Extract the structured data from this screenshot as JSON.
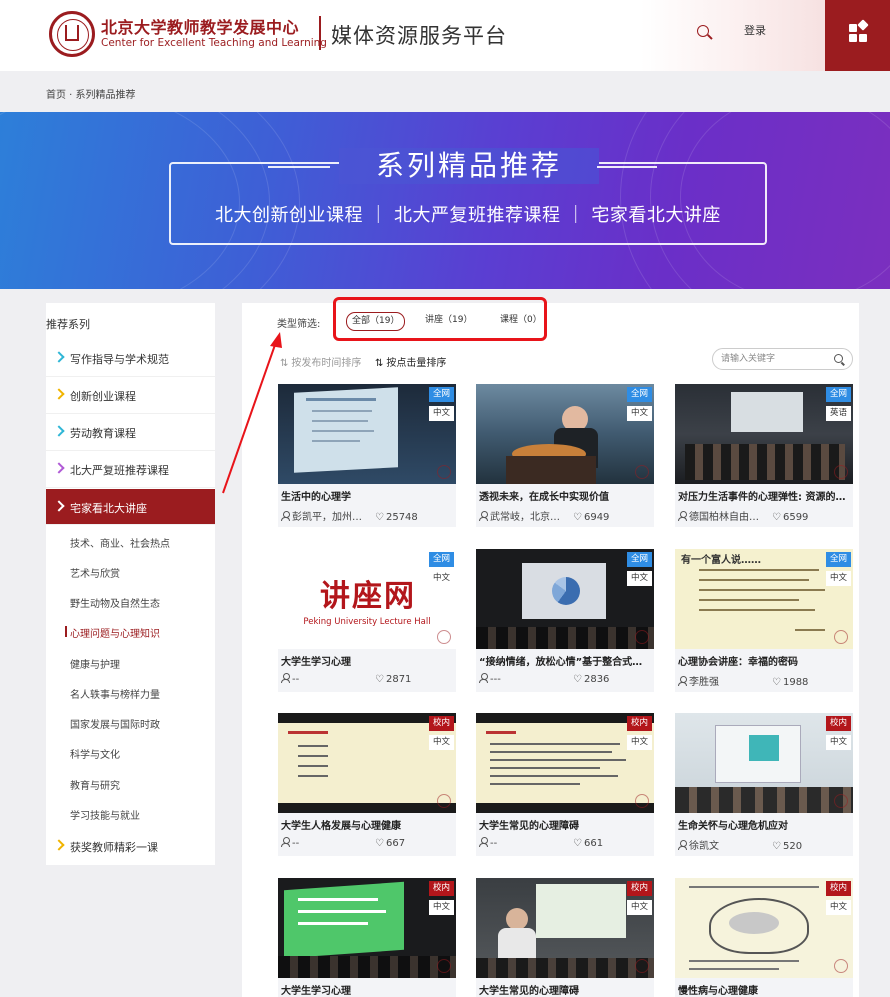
{
  "header": {
    "org_name_cn": "北京大学教师教学发展中心",
    "org_name_en": "Center for Excellent Teaching and Learning",
    "platform_title": "媒体资源服务平台",
    "login_label": "登录",
    "brand_color": "#9b1c1f"
  },
  "breadcrumb": {
    "home": "首页",
    "separator": " · ",
    "current": "系列精品推荐"
  },
  "banner": {
    "title": "系列精品推荐",
    "subtitle": "北大创新创业课程 ｜ 北大严复班推荐课程 ｜ 宅家看北大讲座"
  },
  "sidebar": {
    "title": "推荐系列",
    "items": [
      {
        "label": "写作指导与学术规范",
        "arrow_color": "#2fb6d6"
      },
      {
        "label": "创新创业课程",
        "arrow_color": "#f0b400"
      },
      {
        "label": "劳动教育课程",
        "arrow_color": "#2fb6d6"
      },
      {
        "label": "北大严复班推荐课程",
        "arrow_color": "#b05ad6"
      },
      {
        "label": "宅家看北大讲座",
        "arrow_color": "#ffffff"
      }
    ],
    "sub_items": [
      "技术、商业、社会热点",
      "艺术与欣赏",
      "野生动物及自然生态",
      "心理问题与心理知识",
      "健康与护理",
      "名人轶事与榜样力量",
      "国家发展与国际时政",
      "科学与文化",
      "教育与研究",
      "学习技能与就业"
    ],
    "last_item": {
      "label": "获奖教师精彩一课",
      "arrow_color": "#f0b400"
    }
  },
  "filter": {
    "label": "类型筛选:",
    "tabs": [
      "全部（19）",
      "讲座（19）",
      "课程（0）"
    ]
  },
  "sort": {
    "by_time": "按发布时间排序",
    "by_clicks": "按点击量排序"
  },
  "search": {
    "placeholder": "请输入关键字"
  },
  "cards": [
    {
      "title": "生活中的心理学",
      "author": "彭凯平，加州…",
      "views": "25748",
      "scope": "全网",
      "lang": "中文"
    },
    {
      "title": "透视未来，在成长中实现价值",
      "author": "武常岐，北京…",
      "views": "6949",
      "scope": "全网",
      "lang": "中文"
    },
    {
      "title": "对压力生活事件的心理弹性: 资源的作…",
      "author": "德国柏林自由…",
      "views": "6599",
      "scope": "全网",
      "lang": "英语"
    },
    {
      "title": "大学生学习心理",
      "author": "--",
      "views": "2871",
      "scope": "全网",
      "lang": "中文",
      "thumb_text": "讲座网",
      "thumb_sub": "Peking University Lecture Hall"
    },
    {
      "title": "“接纳情绪，放松心情”基于整合式…",
      "author": "---",
      "views": "2836",
      "scope": "全网",
      "lang": "中文"
    },
    {
      "title": "心理协会讲座：幸福的密码",
      "author": "李胜强",
      "views": "1988",
      "scope": "全网",
      "lang": "中文",
      "thumb_text": "有一个富人说……"
    },
    {
      "title": "大学生人格发展与心理健康",
      "author": "--",
      "views": "667",
      "scope": "校内",
      "lang": "中文"
    },
    {
      "title": "大学生常见的心理障碍",
      "author": "--",
      "views": "661",
      "scope": "校内",
      "lang": "中文"
    },
    {
      "title": "生命关怀与心理危机应对",
      "author": "徐凯文",
      "views": "520",
      "scope": "校内",
      "lang": "中文"
    },
    {
      "title": "大学生学习心理",
      "author": "",
      "views": "",
      "scope": "校内",
      "lang": "中文"
    },
    {
      "title": "大学生常见的心理障碍",
      "author": "",
      "views": "",
      "scope": "校内",
      "lang": "中文"
    },
    {
      "title": "慢性病与心理健康",
      "author": "",
      "views": "",
      "scope": "校内",
      "lang": "中文"
    }
  ],
  "colors": {
    "scope_all": "#2f8de4",
    "scope_campus": "#b3161b",
    "annotation": "#e8141a"
  }
}
